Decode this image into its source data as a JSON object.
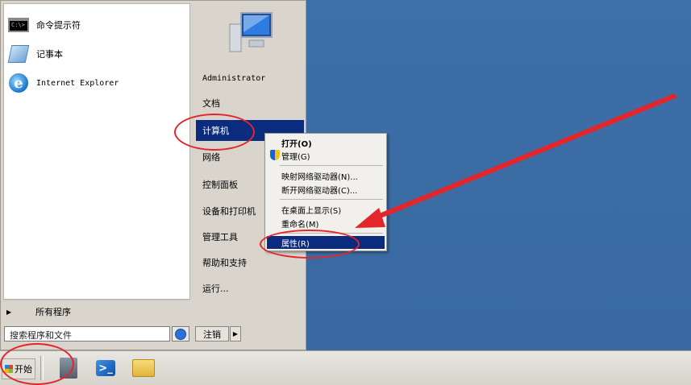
{
  "start_menu": {
    "pinned": [
      {
        "label": "命令提示符",
        "icon": "cmd-icon"
      },
      {
        "label": "记事本",
        "icon": "notepad-icon"
      },
      {
        "label": "Internet Explorer",
        "icon": "ie-icon"
      }
    ],
    "all_programs": "所有程序",
    "search_placeholder": "搜索程序和文件",
    "right_items": [
      {
        "label": "Administrator"
      },
      {
        "label": "文档"
      },
      {
        "label": "计算机"
      },
      {
        "label": "网络"
      },
      {
        "label": "控制面板"
      },
      {
        "label": "设备和打印机"
      },
      {
        "label": "管理工具"
      },
      {
        "label": "帮助和支持"
      },
      {
        "label": "运行..."
      }
    ],
    "logoff": "注销"
  },
  "context_menu": {
    "items": [
      {
        "label": "打开(O)"
      },
      {
        "label": "管理(G)"
      },
      {
        "label": "映射网络驱动器(N)..."
      },
      {
        "label": "断开网络驱动器(C)..."
      },
      {
        "label": "在桌面上显示(S)"
      },
      {
        "label": "重命名(M)"
      },
      {
        "label": "属性(R)"
      }
    ]
  },
  "taskbar": {
    "start_label": "开始"
  },
  "colors": {
    "highlight": "#0a2b7e",
    "annotation": "#e3262c",
    "desktop": "#3a6ea5"
  }
}
